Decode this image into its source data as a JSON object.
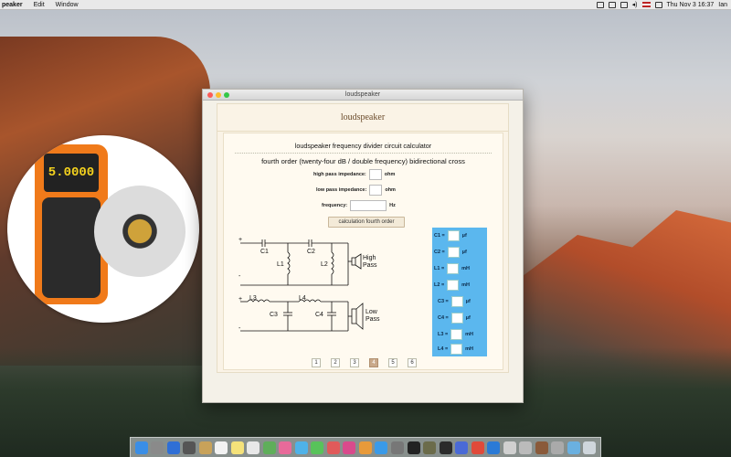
{
  "menubar": {
    "app_name": "peaker",
    "menus": [
      "Edit",
      "Window"
    ],
    "datetime": "Thu Nov 3  16:37",
    "user": "Ian"
  },
  "promo": {
    "meter_display": "5.0000"
  },
  "window": {
    "title": "loudspeaker",
    "page_title": "loudspeaker",
    "calc_title": "loudspeaker frequency divider circuit calculator",
    "order_title": "fourth order (twenty-four dB / double frequency) bidirectional cross",
    "high_pass_label": "high pass impedance:",
    "low_pass_label": "low pass impedance:",
    "frequency_label": "frequency:",
    "ohm_unit": "ohm",
    "hz_unit": "Hz",
    "calc_button": "calculation fourth order",
    "high_pass_value": "",
    "low_pass_value": "",
    "frequency_value": ""
  },
  "circuit": {
    "c1": "C1",
    "c2": "C2",
    "l1": "L1",
    "l2": "L2",
    "l3": "L3",
    "l4": "L4",
    "c3": "C3",
    "c4": "C4",
    "high_pass": [
      "High",
      "Pass"
    ],
    "low_pass": [
      "Low",
      "Pass"
    ],
    "plus": "+",
    "minus": "-"
  },
  "results": [
    {
      "label": "C1 =",
      "unit": "µf"
    },
    {
      "label": "C2 =",
      "unit": "µf"
    },
    {
      "label": "L1 =",
      "unit": "mH"
    },
    {
      "label": "L2 =",
      "unit": "mH"
    },
    {
      "label": "C3 =",
      "unit": "µf"
    },
    {
      "label": "C4 =",
      "unit": "µf"
    },
    {
      "label": "L3 =",
      "unit": "mH"
    },
    {
      "label": "L4 =",
      "unit": "mH"
    }
  ],
  "pager": {
    "pages": [
      "1",
      "2",
      "3",
      "4",
      "5",
      "6"
    ],
    "active": "4"
  },
  "colors": {
    "results_panel": "#5bb7ee",
    "active_page": "#c9a98a"
  }
}
